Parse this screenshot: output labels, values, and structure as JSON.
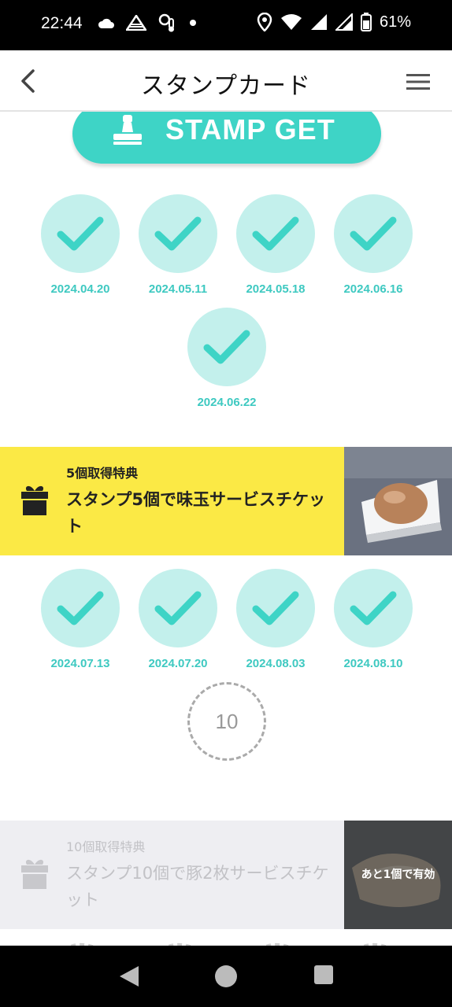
{
  "status_bar": {
    "time": "22:44",
    "battery": "61%"
  },
  "header": {
    "title": "スタンプカード"
  },
  "stamp_get_button": {
    "label": "STAMP GET"
  },
  "stamps_group1": [
    {
      "date": "2024.04.20",
      "stamped": true
    },
    {
      "date": "2024.05.11",
      "stamped": true
    },
    {
      "date": "2024.05.18",
      "stamped": true
    },
    {
      "date": "2024.06.16",
      "stamped": true
    },
    {
      "date": "2024.06.22",
      "stamped": true
    }
  ],
  "reward1": {
    "subtitle": "5個取得特典",
    "title": "スタンプ5個で味玉サービスチケット",
    "image": "seasoned-egg-photo"
  },
  "stamps_group2": [
    {
      "date": "2024.07.13",
      "stamped": true
    },
    {
      "date": "2024.07.20",
      "stamped": true
    },
    {
      "date": "2024.08.03",
      "stamped": true
    },
    {
      "date": "2024.08.10",
      "stamped": true
    },
    {
      "number": "10",
      "stamped": false
    }
  ],
  "reward2": {
    "subtitle": "10個取得特典",
    "title": "スタンプ10個で豚2枚サービスチケット",
    "image": "pork-slices-photo",
    "overlay": "あと1個で有効"
  },
  "colors": {
    "accent": "#3ed4c6",
    "stamp_bg": "#c3f0ec",
    "date_text": "#3ec9c1",
    "reward_active_bg": "#fbe945",
    "reward_inactive_bg": "#eeeef2"
  }
}
